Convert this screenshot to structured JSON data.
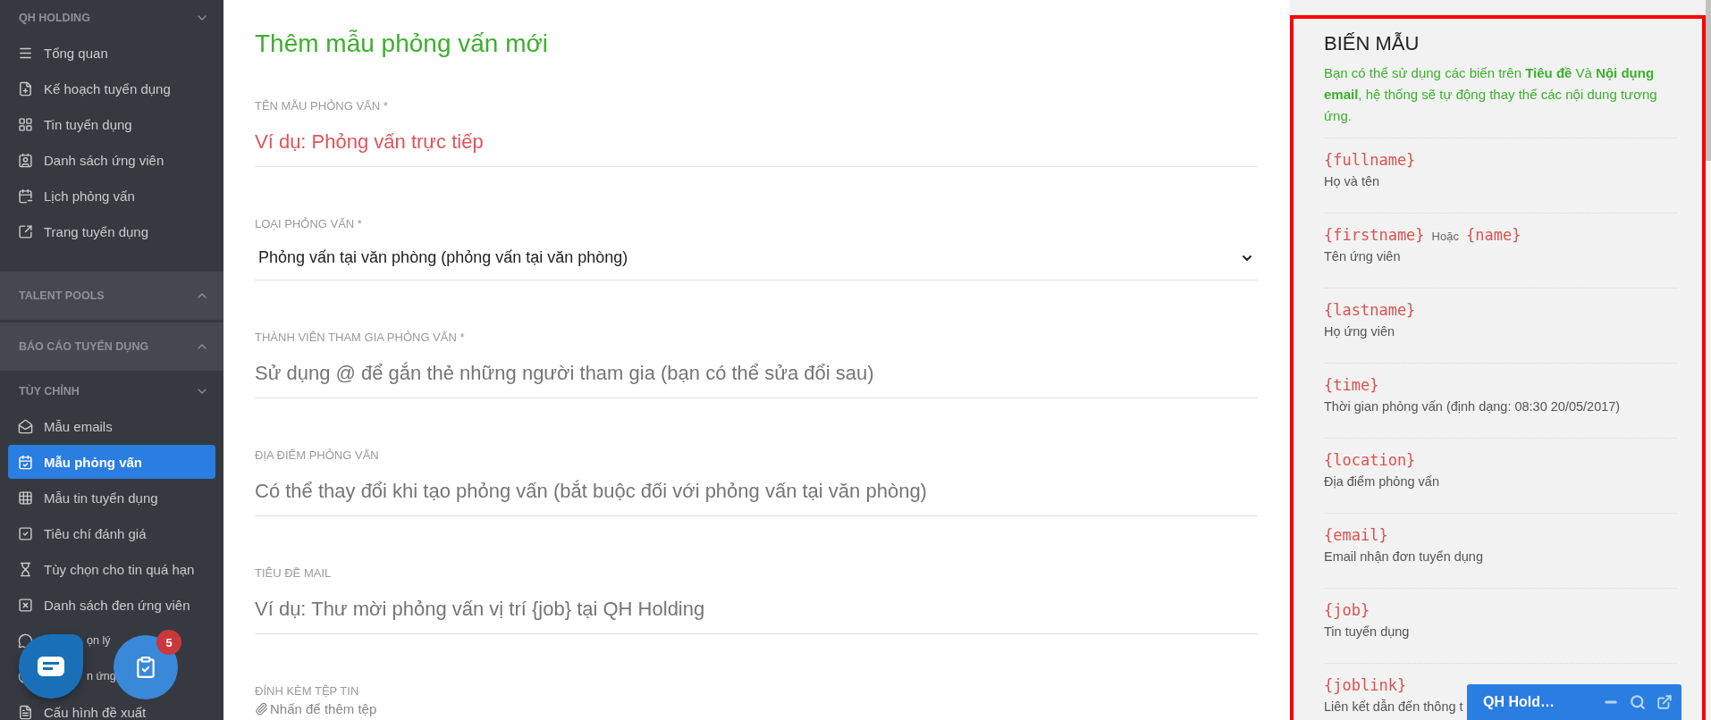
{
  "sidebar": {
    "sections": [
      {
        "title": "QH HOLDING",
        "expanded": true,
        "items": [
          {
            "label": "Tổng quan",
            "selected": false,
            "kind": "normal"
          },
          {
            "label": "Kế hoạch tuyển dụng",
            "selected": false,
            "kind": "normal"
          },
          {
            "label": "Tin tuyển dụng",
            "selected": false,
            "kind": "normal"
          },
          {
            "label": "Danh sách ứng viên",
            "selected": false,
            "kind": "normal"
          },
          {
            "label": "Lịch phỏng vấn",
            "selected": false,
            "kind": "normal"
          },
          {
            "label": "Trang tuyển dụng",
            "selected": false,
            "kind": "normal"
          }
        ]
      },
      {
        "title": "TALENT POOLS",
        "expanded": false
      },
      {
        "title": "BÁO CÁO TUYỂN DỤNG",
        "expanded": false
      },
      {
        "title": "TÙY CHỈNH",
        "expanded": true,
        "items": [
          {
            "label": "Mẫu emails",
            "selected": false,
            "kind": "normal"
          },
          {
            "label": "Mẫu phỏng vấn",
            "selected": true,
            "kind": "normal"
          },
          {
            "label": "Mẫu tin tuyển dụng",
            "selected": false,
            "kind": "normal"
          },
          {
            "label": "Tiêu chí đánh giá",
            "selected": false,
            "kind": "normal"
          },
          {
            "label": "Tùy chọn cho tin quá hạn",
            "selected": false,
            "kind": "normal"
          },
          {
            "label": "Danh sách đen ứng viên",
            "selected": false,
            "kind": "normal"
          },
          {
            "label": "ọn lý",
            "selected": false,
            "kind": "covered"
          },
          {
            "label": "n ứng",
            "selected": false,
            "kind": "covered"
          },
          {
            "label": "Cấu hình đề xuất",
            "selected": false,
            "kind": "normal"
          }
        ]
      }
    ]
  },
  "form": {
    "title": "Thêm mẫu phỏng vấn mới",
    "fields": [
      {
        "label": "TÊN MẪU PHỎNG VẤN *",
        "kind": "text",
        "placeholder": "Ví dụ: Phỏng vấn trực tiếp",
        "invalid": true
      },
      {
        "label": "LOẠI PHỎNG VẤN *",
        "kind": "select",
        "value": "Phỏng vấn tại văn phòng (phỏng vấn tại văn phòng)"
      },
      {
        "label": "THÀNH VIÊN THAM GIA PHỎNG VẤN *",
        "kind": "text",
        "placeholder": "Sử dụng @ để gắn thẻ những người tham gia (bạn có thể sửa đổi sau)",
        "invalid": false
      },
      {
        "label": "ĐỊA ĐIỂM PHỎNG VẤN",
        "kind": "text",
        "placeholder": "Có thể thay đổi khi tạo phỏng vấn (bắt buộc đối với phỏng vấn tại văn phòng)",
        "invalid": false
      },
      {
        "label": "TIÊU ĐỀ MAIL",
        "kind": "text",
        "placeholder": "Ví dụ: Thư mời phỏng vấn vị trí {job} tại QH Holding",
        "invalid": false
      },
      {
        "label": "ĐÍNH KÈM TỆP TIN",
        "kind": "attach",
        "value": "Nhấn để thêm tệp"
      }
    ]
  },
  "variables_panel": {
    "title": "BIẾN MẪU",
    "description": "Bạn có thể sử dụng các biến trên **Tiêu đề** Và **Nội dụng email**, hệ thống sẽ tự động thay thế các nội dung tương ứng.",
    "items": [
      {
        "tokens": [
          {
            "kind": "var",
            "text": "{fullname}"
          }
        ],
        "description": "Họ và tên"
      },
      {
        "tokens": [
          {
            "kind": "var",
            "text": "{firstname}"
          },
          {
            "kind": "sep",
            "text": "Hoặc"
          },
          {
            "kind": "var",
            "text": "{name}"
          }
        ],
        "description": "Tên ứng viên"
      },
      {
        "tokens": [
          {
            "kind": "var",
            "text": "{lastname}"
          }
        ],
        "description": "Họ ứng viên"
      },
      {
        "tokens": [
          {
            "kind": "var",
            "text": "{time}"
          }
        ],
        "description": "Thời gian phỏng vấn (định dạng: 08:30 20/05/2017)"
      },
      {
        "tokens": [
          {
            "kind": "var",
            "text": "{location}"
          }
        ],
        "description": "Địa điểm phỏng vấn"
      },
      {
        "tokens": [
          {
            "kind": "var",
            "text": "{email}"
          }
        ],
        "description": "Email nhận đơn tuyển dụng"
      },
      {
        "tokens": [
          {
            "kind": "var",
            "text": "{job}"
          }
        ],
        "description": "Tin tuyển dụng"
      },
      {
        "tokens": [
          {
            "kind": "var",
            "text": "{joblink}"
          }
        ],
        "description": "Liên kết dẫn đến thông t"
      }
    ]
  },
  "tasks_button": {
    "badge": "5"
  },
  "chat_widget": {
    "title": "QH Hold…"
  }
}
